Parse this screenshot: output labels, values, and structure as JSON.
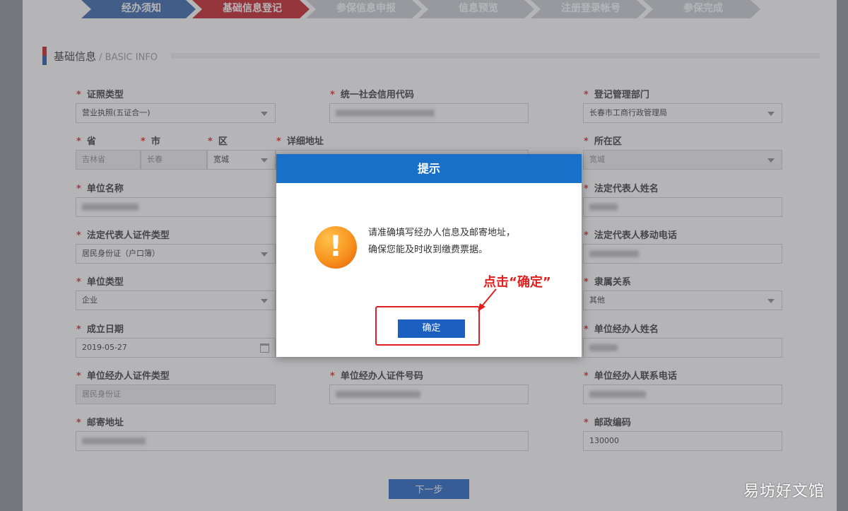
{
  "steps": [
    {
      "label": "经办须知",
      "state": "done"
    },
    {
      "label": "基础信息登记",
      "state": "active"
    },
    {
      "label": "参保信息申报",
      "state": "todo"
    },
    {
      "label": "信息预览",
      "state": "todo"
    },
    {
      "label": "注册登录帐号",
      "state": "todo"
    },
    {
      "label": "参保完成",
      "state": "todo"
    }
  ],
  "section": {
    "title": "基础信息",
    "subtitle": " / BASIC INFO"
  },
  "required_mark": "*",
  "form": {
    "cert_type": {
      "label": "证照类型",
      "value": "营业执照(五证合一)"
    },
    "credit_code": {
      "label": "统一社会信用代码",
      "value": ""
    },
    "reg_dept": {
      "label": "登记管理部门",
      "value": "长春市工商行政管理局"
    },
    "province": {
      "label": "省",
      "value": "吉林省"
    },
    "city": {
      "label": "市",
      "value": "长春"
    },
    "district": {
      "label": "区",
      "value": "宽城"
    },
    "address": {
      "label": "详细地址",
      "value": ""
    },
    "area": {
      "label": "所在区",
      "value": "宽城"
    },
    "unit_name": {
      "label": "单位名称",
      "value": ""
    },
    "legal_name": {
      "label": "法定代表人姓名",
      "value": ""
    },
    "legal_id_type": {
      "label": "法定代表人证件类型",
      "value": "居民身份证（户口簿）"
    },
    "legal_phone": {
      "label": "法定代表人移动电话",
      "value": ""
    },
    "unit_type": {
      "label": "单位类型",
      "value": "企业"
    },
    "affiliation": {
      "label": "隶属关系",
      "value": "其他"
    },
    "est_date": {
      "label": "成立日期",
      "value": "2019-05-27"
    },
    "agent_name": {
      "label": "单位经办人姓名",
      "value": ""
    },
    "agent_id_type": {
      "label": "单位经办人证件类型",
      "value": "居民身份证"
    },
    "agent_id_no": {
      "label": "单位经办人证件号码",
      "value": ""
    },
    "agent_phone": {
      "label": "单位经办人联系电话",
      "value": ""
    },
    "mail_addr": {
      "label": "邮寄地址",
      "value": ""
    },
    "postcode": {
      "label": "邮政编码",
      "value": "130000"
    }
  },
  "next_button": "下一步",
  "modal": {
    "title": "提示",
    "icon": "warning-icon",
    "message": "请准确填写经办人信息及邮寄地址，确保您能及时收到缴费票据。",
    "ok_label": "确定"
  },
  "annotation": {
    "text": "点击“确定”",
    "color": "#e02020"
  },
  "watermark": "易坊好文馆",
  "colors": {
    "active_step": "#c4161c",
    "done_step": "#2f5fa8",
    "todo_step": "#c9ccd2",
    "primary": "#1b5fc1",
    "modal_header": "#1870c8"
  }
}
